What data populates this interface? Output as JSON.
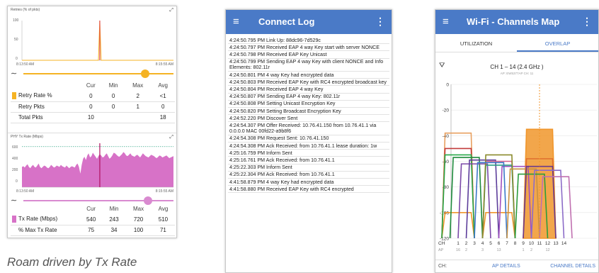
{
  "panel1": {
    "retries_chart": {
      "title": "Retries (% of pkts)",
      "y_ticks": [
        "100",
        "50",
        "0"
      ],
      "x_start": "8:13:50 AM",
      "x_end": "8:15:55 AM",
      "expand_glyph": "⤢"
    },
    "retries_slider_fraction": 0.81,
    "retries_table": {
      "columns": [
        "",
        "Cur",
        "Min",
        "Max",
        "Avg"
      ],
      "rows": [
        {
          "label": "Retry Rate %",
          "cur": "0",
          "min": "0",
          "max": "2",
          "avg": "<1",
          "swatch": "#f5b324"
        },
        {
          "label": "Retry Pkts",
          "cur": "0",
          "min": "0",
          "max": "1",
          "avg": "0",
          "swatch": ""
        },
        {
          "label": "Total Pkts",
          "cur": "10",
          "min": "",
          "max": "",
          "avg": "18",
          "swatch": ""
        }
      ]
    },
    "phy_chart": {
      "title": "PHY Tx Rate (Mbps)",
      "y_ticks": [
        "600",
        "400",
        "200",
        "0"
      ],
      "x_start": "8:13:50 AM",
      "x_end": "8:15:55 AM",
      "expand_glyph": "⤢"
    },
    "phy_slider_fraction": 0.83,
    "phy_table": {
      "columns": [
        "",
        "Cur",
        "Min",
        "Max",
        "Avg"
      ],
      "rows": [
        {
          "label": "Tx Rate (Mbps)",
          "cur": "540",
          "min": "243",
          "max": "720",
          "avg": "510",
          "swatch": "#d772c7"
        },
        {
          "label": "% Max Tx Rate",
          "cur": "75",
          "min": "34",
          "max": "100",
          "avg": "71",
          "swatch": ""
        }
      ]
    },
    "zoom_glyph": "∼",
    "caption": "Roam driven by Tx Rate"
  },
  "panel2": {
    "menu_icon": "≡",
    "title": "Connect Log",
    "more_icon": "⋮",
    "entries": [
      "4:24:50.795 PM Link Up: 88dc96-7d529c",
      "4:24:50.797 PM Received EAP 4 way Key start with server NONCE",
      "4:24:50.798 PM Received EAP Key Unicast",
      "4:24:50.799 PM Sending EAP 4 way Key with client NONCE and Info Elements: 802.11r",
      "4:24:50.801 PM 4 way Key had encrypted data",
      "4:24:50.803 PM Received EAP Key with RC4 encrypted broadcast key",
      "4:24:50.804 PM Received EAP 4 way Key",
      "4:24:50.807 PM Sending EAP 4 way Key: 802.11r",
      "4:24:50.808 PM Setting Unicast Encryption Key",
      "4:24:50.820 PM Setting Broadcast Encryption Key",
      "4:24:52.220 PM Discover Sent",
      "4:24:54.307 PM Offer Received: 10.76.41.150 from 10.76.41.1 via 0.0.0.0 MAC 00fd22-a9b8f6",
      "4:24:54.308 PM Request Sent: 10.76.41.150",
      "4:24:54.308 PM Ack Received: from 10.76.41.1 lease duration: 1w",
      "4:25:16.759 PM Inform Sent",
      "4:25:16.761 PM Ack Received: from 10.76.41.1",
      "4:25:22.303 PM Inform Sent",
      "4:25:22.304 PM Ack Received: from 10.76.41.1",
      "4:41:58.879 PM 4 way Key had encrypted data",
      "4:41:58.880 PM Received EAP Key with RC4 encrypted"
    ]
  },
  "panel3": {
    "menu_icon": "≡",
    "title": "Wi-Fi - Channels Map",
    "more_icon": "⋮",
    "tabs": [
      {
        "label": "UTILIZATION",
        "active": false
      },
      {
        "label": "OVERLAP",
        "active": true
      }
    ],
    "filter_icon": "⛛",
    "channel_heading": "CH 1 – 14 (2.4 GHz )",
    "channel_sub": "AP: EW5377AP CH: 11",
    "footer": {
      "left": "CH:",
      "ap_details": "AP DETAILS",
      "channel_details": "CHANNEL DETAILS"
    }
  },
  "chart_data": [
    {
      "type": "line",
      "title": "Retries (% of pkts)",
      "ylim": [
        0,
        100
      ],
      "y_ticks": [
        100,
        50,
        0
      ],
      "x_labels": [
        "8:13:50 AM",
        "8:15:55 AM"
      ],
      "series": [
        {
          "name": "Retry Rate %",
          "color": "#f5b324",
          "values": [
            0,
            0,
            0,
            0,
            0,
            0,
            0,
            0,
            0,
            0,
            0,
            0,
            0,
            0,
            0,
            0,
            0,
            0,
            0,
            0,
            0,
            0,
            0,
            0,
            0,
            0,
            0,
            0,
            0,
            0,
            0,
            0,
            0,
            0,
            0,
            0,
            0,
            0,
            0,
            0,
            0,
            0,
            0,
            0,
            0,
            0,
            0,
            0,
            0,
            0,
            0,
            0,
            0,
            0,
            0,
            0,
            100,
            0,
            0,
            0,
            0,
            0,
            0,
            0,
            0,
            0,
            0,
            0,
            0,
            0,
            0,
            0,
            0,
            0,
            0,
            0,
            0,
            0,
            0,
            0,
            0,
            0,
            0,
            0,
            0,
            0,
            0,
            0,
            0,
            0,
            0,
            0,
            0,
            0,
            0,
            0,
            0,
            0,
            0,
            0,
            0,
            0,
            0,
            0,
            0,
            0,
            0,
            0,
            0,
            0
          ]
        }
      ],
      "markers": [
        {
          "color": "#e04a4a",
          "at_index": 56
        }
      ]
    },
    {
      "type": "area",
      "title": "PHY Tx Rate (Mbps)",
      "ylim": [
        0,
        650
      ],
      "y_ticks": [
        600,
        400,
        200,
        0
      ],
      "x_labels": [
        "8:13:50 AM",
        "8:15:55 AM"
      ],
      "reference": {
        "value": 600,
        "color": "#3aa88a"
      },
      "series": [
        {
          "name": "Tx Rate (Mbps)",
          "color": "#d772c7",
          "values": [
            300,
            310,
            290,
            320,
            340,
            300,
            280,
            310,
            330,
            300,
            290,
            320,
            350,
            300,
            280,
            300,
            320,
            310,
            290,
            280,
            300,
            330,
            310,
            290,
            300,
            320,
            310,
            300,
            330,
            310,
            300,
            290,
            320,
            300,
            280,
            300,
            310,
            300,
            290,
            330,
            350,
            300,
            200,
            330,
            420,
            450,
            400,
            470,
            500,
            440,
            460,
            510,
            480,
            450,
            420,
            460,
            490,
            470,
            440,
            450,
            480,
            500,
            460,
            420,
            440,
            470,
            510,
            500,
            480,
            460,
            450,
            470,
            490,
            520,
            500,
            470,
            460,
            480,
            500,
            470,
            460,
            450,
            470,
            480,
            460,
            440,
            470,
            500,
            480,
            460,
            450,
            440,
            460,
            480,
            470,
            460,
            440,
            430,
            450,
            470,
            460,
            440,
            450,
            460,
            470,
            450,
            430,
            440,
            450,
            460
          ]
        }
      ],
      "markers": [
        {
          "color": "#b01060",
          "at_index": 56
        }
      ]
    },
    {
      "type": "line",
      "title": "CH 1 – 14 (2.4 GHz )",
      "x": [
        1,
        2,
        3,
        4,
        5,
        6,
        7,
        8,
        9,
        10,
        11,
        12,
        13,
        14
      ],
      "ylim": [
        -120,
        0
      ],
      "y_ticks": [
        0,
        -20,
        -40,
        -60,
        -80,
        -100,
        -120
      ],
      "x_axis_label": "CH",
      "ap_label": "AP",
      "ap_counts": [
        "16",
        "2",
        "",
        "3",
        "",
        "13",
        "",
        "",
        "1",
        "2",
        "",
        "12",
        "",
        ""
      ],
      "highlight_channel": 11,
      "series": [
        {
          "color": "#f0962c",
          "channel": 11,
          "top": -35,
          "fill": true
        },
        {
          "color": "#f0962c",
          "channel": 1,
          "top": -100,
          "fill": false
        },
        {
          "color": "#f0962c",
          "channel": 6,
          "top": -100,
          "fill": false
        },
        {
          "color": "#e8a060",
          "channel": 1,
          "top": -38,
          "fill": false
        },
        {
          "color": "#c23b3b",
          "channel": 1,
          "top": -50,
          "fill": false
        },
        {
          "color": "#28a848",
          "channel": 1,
          "top": -55,
          "fill": false
        },
        {
          "color": "#1e8a3c",
          "channel": 2,
          "top": -57,
          "fill": false
        },
        {
          "color": "#7a48a8",
          "channel": 3,
          "top": -62,
          "fill": false
        },
        {
          "color": "#5c3d9a",
          "channel": 4,
          "top": -59,
          "fill": false
        },
        {
          "color": "#a050c0",
          "channel": 8,
          "top": -64,
          "fill": false
        },
        {
          "color": "#d6608a",
          "channel": 6,
          "top": -60,
          "fill": false
        },
        {
          "color": "#2f9e84",
          "channel": 6,
          "top": -63,
          "fill": false
        },
        {
          "color": "#8a8a2c",
          "channel": 6,
          "top": -55,
          "fill": false
        },
        {
          "color": "#3c78c8",
          "channel": 5,
          "top": -61,
          "fill": false
        },
        {
          "color": "#c89040",
          "channel": 9,
          "top": -66,
          "fill": false
        },
        {
          "color": "#e07030",
          "channel": 11,
          "top": -58,
          "fill": false
        },
        {
          "color": "#6a3a8c",
          "channel": 11,
          "top": -64,
          "fill": false
        },
        {
          "color": "#2c9c3c",
          "channel": 10,
          "top": -70,
          "fill": false
        },
        {
          "color": "#8c6cc8",
          "channel": 12,
          "top": -67,
          "fill": false
        },
        {
          "color": "#c070b0",
          "channel": 13,
          "top": -72,
          "fill": false
        }
      ]
    }
  ],
  "colors": {
    "appbar": "#4a7ac7",
    "retry_line": "#f5b324",
    "retry_knob": "#f5b324",
    "phy_fill": "#d772c7",
    "phy_knob": "#d98ad0",
    "phy_ref": "#3aa88a",
    "tab_active": "#4a7ac7",
    "highlight": "#f0962c"
  }
}
